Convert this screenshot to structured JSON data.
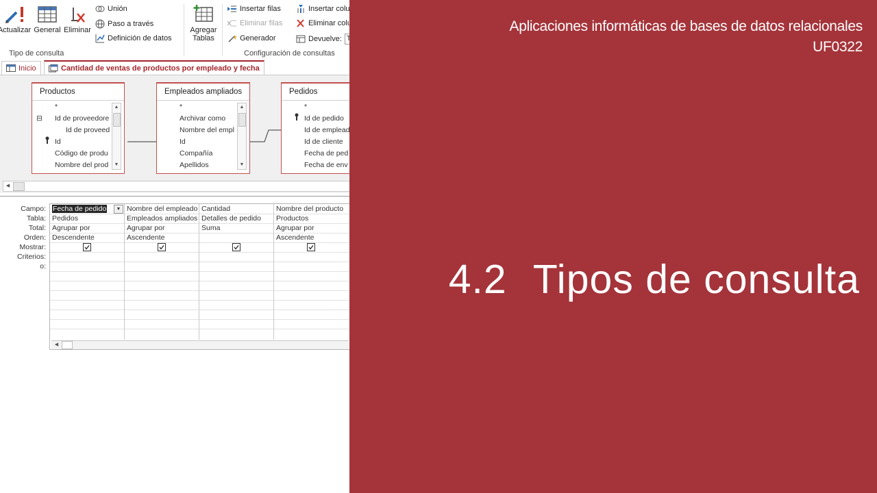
{
  "ribbon": {
    "groups": {
      "query_type": {
        "label": "Tipo de consulta",
        "buttons": {
          "actualizar": "Actualizar",
          "general": "General",
          "eliminar": "Eliminar",
          "union": "Unión",
          "paso": "Paso a través",
          "definicion": "Definición de datos"
        }
      },
      "query_setup": {
        "label": "Configuración de consultas",
        "buttons": {
          "agregar_tablas_l1": "Agregar",
          "agregar_tablas_l2": "Tablas",
          "insertar_filas": "Insertar filas",
          "eliminar_filas": "Eliminar filas",
          "generador": "Generador",
          "insertar_columnas": "Insertar colu",
          "eliminar_columnas": "Eliminar colu",
          "devuelve_label": "Devuelve:",
          "devuelve_value": "T"
        }
      }
    }
  },
  "tabs": [
    {
      "label": "Inicio",
      "icon": "table-icon"
    },
    {
      "label": "Cantidad de ventas de productos por empleado y fecha",
      "icon": "query-icon"
    }
  ],
  "design": {
    "tables": [
      {
        "title": "Productos",
        "fields": [
          "*",
          "Id de proveedore",
          "Id de proveed",
          "Id",
          "Código de produ",
          "Nombre del prod"
        ]
      },
      {
        "title": "Empleados ampliados",
        "fields": [
          "*",
          "Archivar como",
          "Nombre del empl",
          "Id",
          "Compañía",
          "Apellidos"
        ]
      },
      {
        "title": "Pedidos",
        "fields": [
          "*",
          "Id de pedido",
          "Id de emplead",
          "Id de cliente",
          "Fecha de ped",
          "Fecha de env"
        ]
      }
    ]
  },
  "qbe": {
    "row_labels": [
      "Campo:",
      "Tabla:",
      "Total:",
      "Orden:",
      "Mostrar:",
      "Criterios:",
      "o:"
    ],
    "columns": [
      {
        "campo": "Fecha de pedido",
        "tabla": "Pedidos",
        "total": "Agrupar por",
        "orden": "Descendente",
        "mostrar": true
      },
      {
        "campo": "Nombre del empleado",
        "tabla": "Empleados ampliados",
        "total": "Agrupar por",
        "orden": "Ascendente",
        "mostrar": true
      },
      {
        "campo": "Cantidad",
        "tabla": "Detalles de pedido",
        "total": "Suma",
        "orden": "",
        "mostrar": true
      },
      {
        "campo": "Nombre del producto",
        "tabla": "Productos",
        "total": "Agrupar por",
        "orden": "Ascendente",
        "mostrar": true
      }
    ]
  },
  "slide": {
    "course_line1": "Aplicaciones informáticas de bases de datos relacionales",
    "course_line2": "UF0322",
    "section_number": "4.2",
    "section_title": "Tipos de consulta",
    "background_color": "#a4343a"
  }
}
